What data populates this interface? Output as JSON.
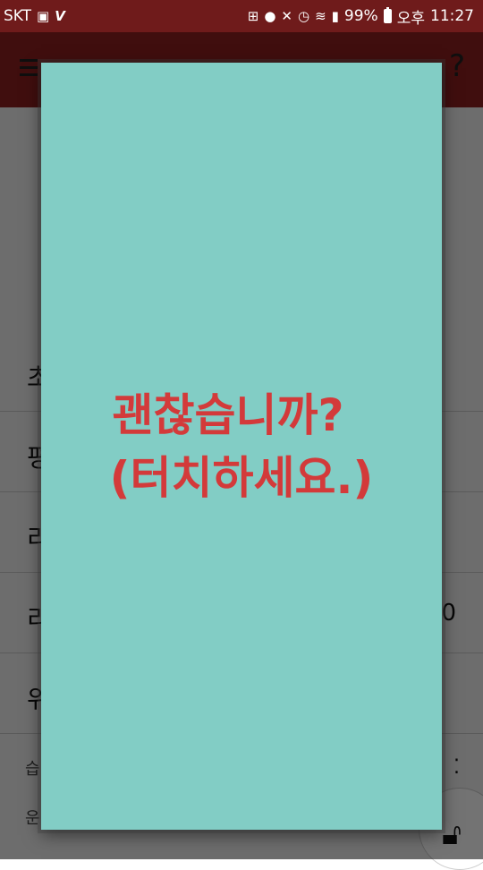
{
  "status_bar": {
    "carrier": "SKT",
    "battery_percent": "99%",
    "am_pm": "오후",
    "time": "11:27",
    "icons_left": [
      "image-icon",
      "v3-app-icon"
    ],
    "icons_right": [
      "battery-saver-icon",
      "location-icon",
      "mute-icon",
      "alarm-icon",
      "wifi-icon",
      "signal-icon",
      "battery-icon"
    ]
  },
  "app_bar": {
    "menu_icon": "hamburger-menu-icon",
    "help_icon": "help-icon"
  },
  "background_list": {
    "rows": [
      {
        "leading": "초",
        "trailing": ""
      },
      {
        "leading": "평",
        "trailing": ""
      },
      {
        "leading": "리",
        "trailing": ""
      },
      {
        "leading": "리",
        "trailing": "0"
      },
      {
        "leading": "위",
        "trailing": ""
      }
    ],
    "footer_lines": [
      "습",
      "운"
    ]
  },
  "dialog": {
    "line1": "괜찮습니까?",
    "line2": "(터치하세요.)",
    "background_color": "#82cdc5",
    "text_color": "#d33a3a"
  },
  "colors": {
    "status_bar": "#6f1b1b",
    "app_bar": "#8e2020"
  }
}
